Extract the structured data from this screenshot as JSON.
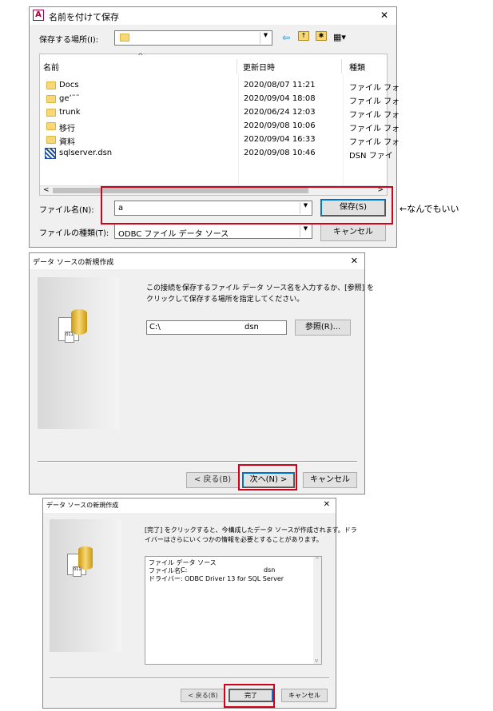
{
  "save_dialog": {
    "title": "名前を付けて保存",
    "app_icon_letter": "A",
    "close_glyph": "✕",
    "location_label": "保存する場所(I):",
    "location_value": "",
    "toolbar_icons": [
      "back-arrow-icon",
      "up-folder-icon",
      "new-folder-icon",
      "view-menu-icon"
    ],
    "columns": {
      "name": "名前",
      "modified": "更新日時",
      "type": "種類"
    },
    "sort_glyph": "^",
    "files": [
      {
        "name": "Docs",
        "modified": "2020/08/07 11:21",
        "type": "ファイル フォ",
        "icon": "folder-icon"
      },
      {
        "name": "geʼ˜˜",
        "modified": "2020/09/04 18:08",
        "type": "ファイル フォ",
        "icon": "folder-icon"
      },
      {
        "name": "trunk",
        "modified": "2020/06/24 12:03",
        "type": "ファイル フォ",
        "icon": "folder-icon"
      },
      {
        "name": "移行",
        "modified": "2020/09/08 10:06",
        "type": "ファイル フォ",
        "icon": "folder-icon"
      },
      {
        "name": "資料",
        "modified": "2020/09/04 16:33",
        "type": "ファイル フォ",
        "icon": "folder-icon"
      },
      {
        "name": "sqlserver.dsn",
        "modified": "2020/09/08 10:46",
        "type": "DSN ファイ",
        "icon": "dsn-file-icon"
      }
    ],
    "scroll_left_glyph": "<",
    "scroll_right_glyph": ">",
    "filename_label": "ファイル名(N):",
    "filename_value": "a",
    "filetype_label": "ファイルの種類(T):",
    "filetype_value": "ODBC ファイル データ ソース",
    "save_button": "保存(S)",
    "cancel_button": "キャンセル",
    "combo_arrow": "▼"
  },
  "annotation": "←なんでもいい",
  "wizard1": {
    "title": "データ ソースの新規作成",
    "close_glyph": "✕",
    "instruction": [
      "この接続を保存するファイル データ ソース名を入力するか、[参照] を",
      "クリックして保存する場所を指定してください。"
    ],
    "path_prefix": "C:\\",
    "path_suffix": "dsn",
    "browse_button": "参照(R)...",
    "back_button": "< 戻る(B)",
    "next_button": "次へ(N) >",
    "cancel_button": "キャンセル"
  },
  "wizard2": {
    "title": "データ ソースの新規作成",
    "close_glyph": "✕",
    "instruction": [
      "[完了] をクリックすると、今構成したデータ ソースが作成されます。ドラ",
      "イバーはさらにいくつかの情報を必要とすることがあります。"
    ],
    "summary_line1": "ファイル データ ソース",
    "summary_filename_label": "ファイル名:",
    "summary_filename_prefix": "C:",
    "summary_filename_suffix": "dsn",
    "summary_driver": "ドライバー:  ODBC Driver 13 for SQL Server",
    "back_button": "< 戻る(B)",
    "finish_button": "完了",
    "cancel_button": "キャンセル",
    "scroll_up_glyph": "^",
    "scroll_down_glyph": "v"
  },
  "colors": {
    "highlight": "#d0021b",
    "dialog_bg": "#f0f0f0",
    "accent": "#0078d7"
  }
}
